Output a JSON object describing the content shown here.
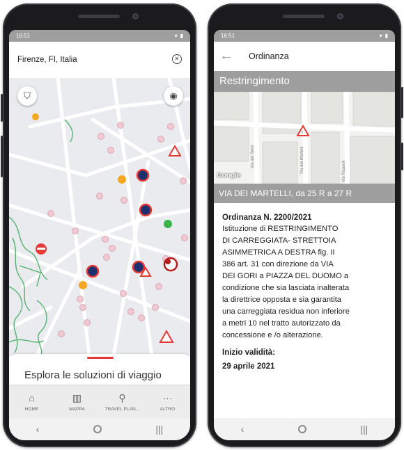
{
  "left_screen": {
    "status_time": "16:51",
    "search": {
      "value": "Firenze, FI, Italia"
    },
    "sheet_title": "Esplora le soluzioni di viaggio",
    "bottom_nav": [
      {
        "label": "HOME",
        "icon": "home-icon"
      },
      {
        "label": "MAPPA",
        "icon": "map-icon"
      },
      {
        "label": "TRAVEL PLAN...",
        "icon": "search-icon"
      },
      {
        "label": "ALTRO",
        "icon": "more-icon"
      }
    ],
    "colors": {
      "accent": "#e53935",
      "navy": "#1c2f6e",
      "orange": "#f5a623",
      "green": "#3bb54a"
    }
  },
  "right_screen": {
    "status_time": "16:51",
    "title": "Ordinanza",
    "section_header": "Restringimento",
    "map_street_labels": [
      "Via dei Servi",
      "Via dei Martelli",
      "Via Ricasoli"
    ],
    "map_brand": "Google",
    "street_range": "VIA DEI MARTELLI, da 25 R a 27 R",
    "ordinance_number": "Ordinanza N. 2200/2021",
    "ordinance_lines": [
      "Istituzione di RESTRINGIMENTO",
      "DI CARREGGIATA- STRETTOIA",
      "ASIMMETRICA A DESTRA fig. II",
      "386 art. 31 con direzione da VIA",
      "DEI GORI a PIAZZA DEL DUOMO a",
      "condizione che sia lasciata inalterata",
      "la direttrice opposta e sia garantita",
      "una carreggiata residua non inferiore",
      "a metri  10  nel tratto autorizzato da",
      "concessione e /o alterazione."
    ],
    "validity_label": "Inizio validità:",
    "validity_date": "29 aprile 2021"
  }
}
